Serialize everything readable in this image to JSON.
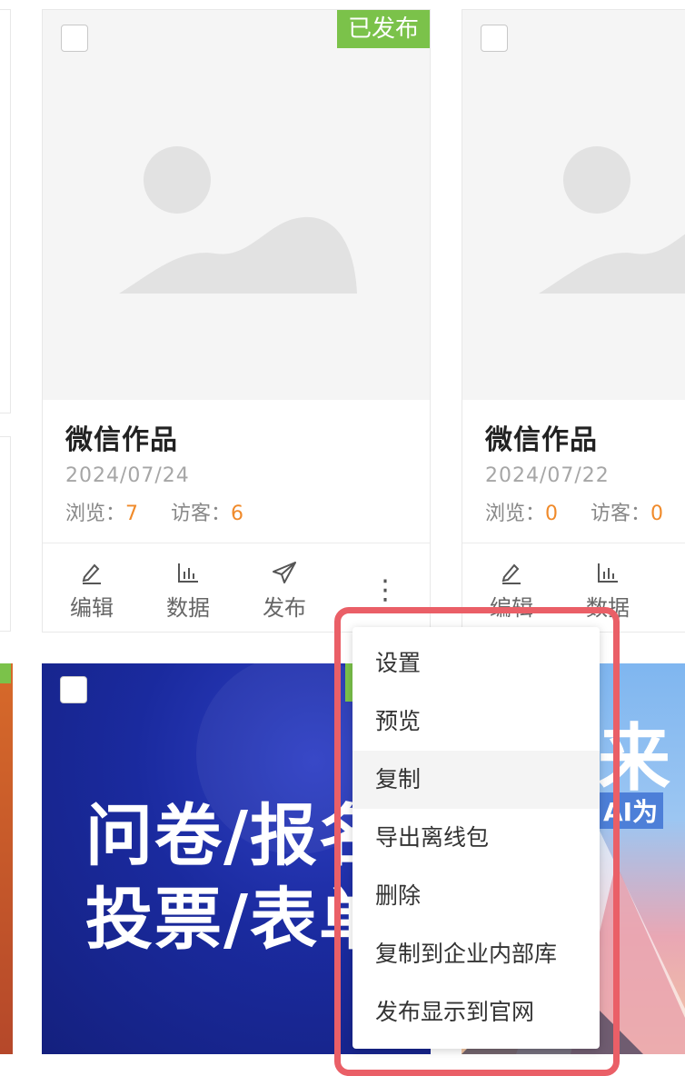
{
  "cards": [
    {
      "title": "微信作品",
      "date": "2024/07/24",
      "views_label": "浏览：",
      "views": "7",
      "visitors_label": "访客：",
      "visitors": "6",
      "badge": "已发布"
    },
    {
      "title": "微信作品",
      "date": "2024/07/22",
      "views_label": "浏览：",
      "views": "0",
      "visitors_label": "访客：",
      "visitors": "0"
    }
  ],
  "actions": {
    "edit": "编辑",
    "data": "数据",
    "publish": "发布",
    "more": "⋮"
  },
  "banner_left": {
    "line1": "问卷/报名",
    "line2": "投票/表单"
  },
  "banner_right": {
    "line1": "来",
    "line2": "AI为"
  },
  "context_menu": {
    "items": [
      "设置",
      "预览",
      "复制",
      "导出离线包",
      "删除",
      "复制到企业内部库",
      "发布显示到官网"
    ],
    "hovered_index": 2
  },
  "colors": {
    "badge": "#7bc24a",
    "stat_number": "#f08a2a",
    "highlight": "#ea5f67",
    "banner_bg": "#1a2a9e"
  }
}
